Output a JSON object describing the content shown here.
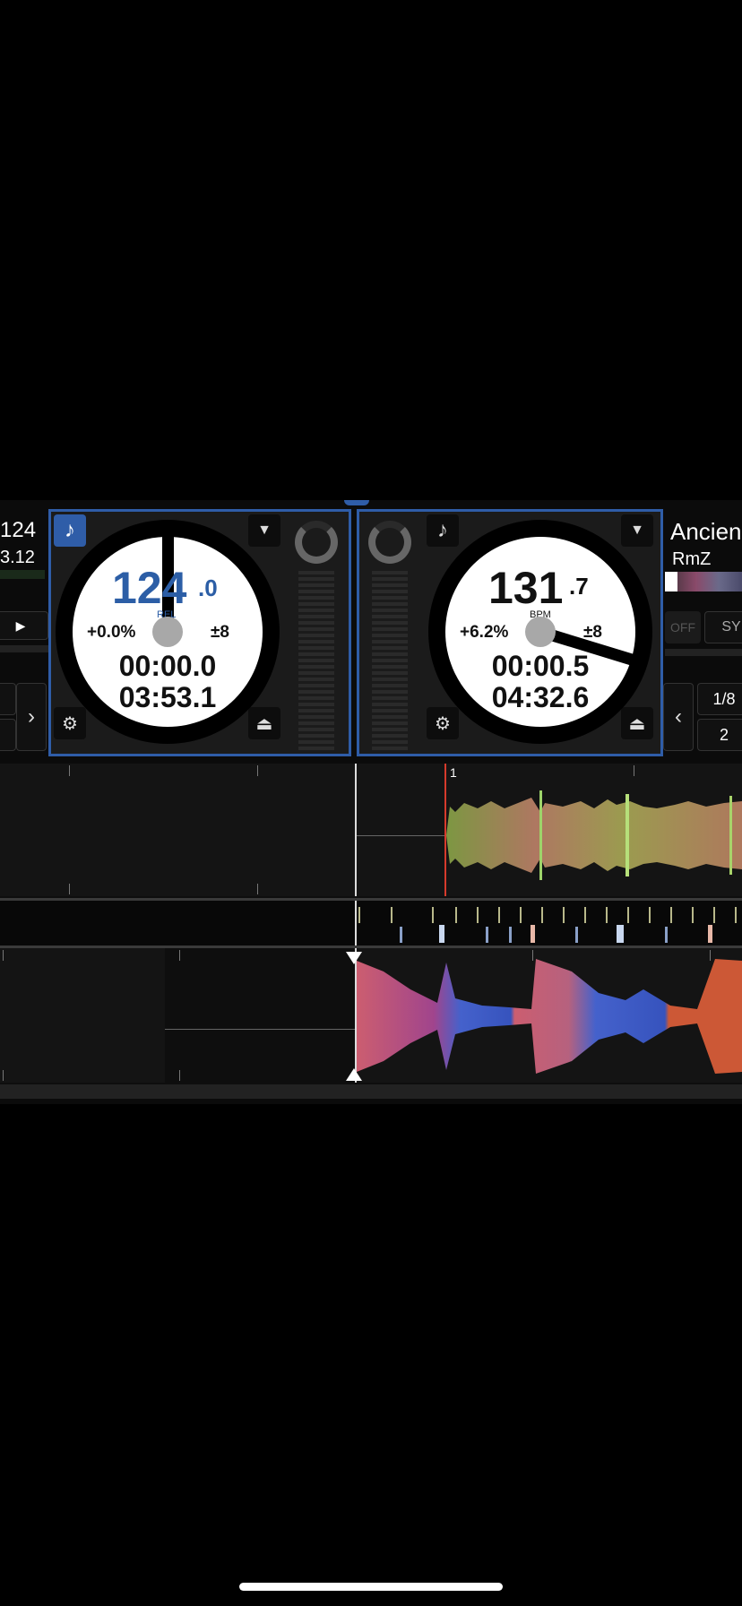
{
  "deck_left": {
    "bpm_whole": "124",
    "bpm_decimal": ".0",
    "bpm_label": "REL",
    "pitch": "+0.0%",
    "pitch_range": "±8",
    "elapsed": "00:00.0",
    "remaining": "03:53.1",
    "partial_bpm": "124",
    "partial_value": "3.12"
  },
  "deck_right": {
    "bpm_whole": "131",
    "bpm_decimal": ".7",
    "bpm_label": "BPM",
    "pitch": "+6.2%",
    "pitch_range": "±8",
    "elapsed": "00:00.5",
    "remaining": "04:32.6",
    "title": "Ancien",
    "artist": "RmZ",
    "off_label": "OFF",
    "sync_label": "SY",
    "loop_size": "1/8",
    "loop_count": "2"
  },
  "waveform": {
    "beat_marker": "1"
  },
  "colors": {
    "accent": "#2f5da8",
    "sync_active_bpm": "#2c5ea6"
  },
  "icons": [
    "music-note-icon",
    "dropdown-triangle-icon",
    "pitch-dial-icon",
    "eject-icon",
    "chevron-left-icon",
    "chevron-right-icon"
  ]
}
